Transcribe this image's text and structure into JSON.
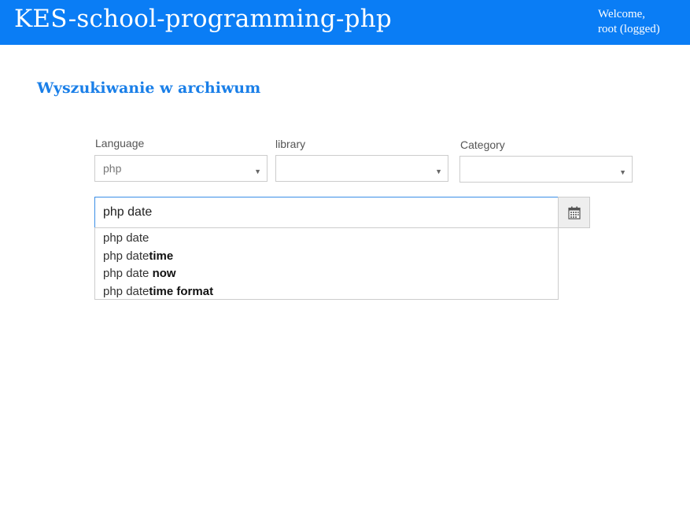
{
  "header": {
    "title": "KES-school-programming-php",
    "welcome_line1": "Welcome,",
    "welcome_line2": "root (logged)"
  },
  "page": {
    "heading": "Wyszukiwanie w archiwum"
  },
  "filters": {
    "language": {
      "label": "Language",
      "value": "php"
    },
    "library": {
      "label": "library",
      "value": ""
    },
    "category": {
      "label": "Category",
      "value": ""
    }
  },
  "search": {
    "value": "php date",
    "suggestions": [
      {
        "prefix": "php date",
        "completion": ""
      },
      {
        "prefix": "php date",
        "completion": "time"
      },
      {
        "prefix": "php date ",
        "completion": "now"
      },
      {
        "prefix": "php date",
        "completion": "time format"
      }
    ]
  },
  "icons": {
    "calendar": "calendar-icon",
    "caret": "caret-down-icon"
  },
  "colors": {
    "header_bg": "#0a7df5",
    "heading": "#1a7fe8",
    "input_border_focus": "#3a8ee6"
  }
}
